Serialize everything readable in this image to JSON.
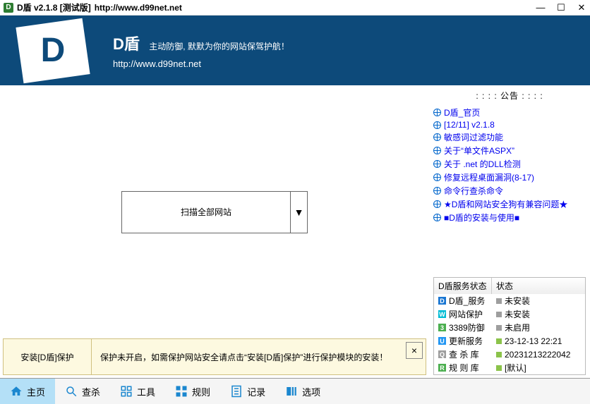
{
  "titlebar": {
    "icon_letter": "D",
    "title": "D盾 v2.1.8 [测试版]",
    "url": "http://www.d99net.net"
  },
  "banner": {
    "logo_letter": "D",
    "title": "D盾",
    "slogan": "主动防御, 默默为你的网站保驾护航！",
    "url": "http://www.d99net.net"
  },
  "scan": {
    "label": "扫描全部网站",
    "arrow": "▼"
  },
  "notice": {
    "button": "安装[D盾]保护",
    "text": "保护未开启，如需保护网站安全请点击“安装[D盾]保护”进行保护模块的安装！",
    "close": "×"
  },
  "announce": {
    "title": ": : : :  公告  : : : :",
    "items": [
      "D盾_官页",
      "[12/11] v2.1.8",
      "敏感词过滤功能",
      "关于“单文件ASPX”",
      "关于 .net 的DLL检测",
      "修复远程桌面漏洞(8-17)",
      "命令行查杀命令",
      "★D盾和网站安全狗有兼容问题★",
      "■D盾的安装与使用■"
    ]
  },
  "status": {
    "header_service": "D盾服务状态",
    "header_state": "状态",
    "rows": [
      {
        "icon": "D",
        "cls": "ico-d",
        "name": "D盾_服务",
        "dot": "",
        "value": "未安装"
      },
      {
        "icon": "W",
        "cls": "ico-w",
        "name": "网站保护",
        "dot": "",
        "value": "未安装"
      },
      {
        "icon": "3",
        "cls": "ico-3",
        "name": "3389防御",
        "dot": "",
        "value": "未启用"
      },
      {
        "icon": "U",
        "cls": "ico-u",
        "name": "更新服务",
        "dot": "green",
        "value": "23-12-13 22:21"
      },
      {
        "icon": "Q",
        "cls": "ico-k",
        "name": "查 杀 库",
        "dot": "green",
        "value": "20231213222042"
      },
      {
        "icon": "R",
        "cls": "ico-r",
        "name": "规 则 库",
        "dot": "green",
        "value": "[默认]"
      }
    ]
  },
  "nav": {
    "items": [
      {
        "key": "home",
        "label": "主页",
        "active": true
      },
      {
        "key": "scan",
        "label": "查杀",
        "active": false
      },
      {
        "key": "tools",
        "label": "工具",
        "active": false
      },
      {
        "key": "rules",
        "label": "规则",
        "active": false
      },
      {
        "key": "log",
        "label": "记录",
        "active": false
      },
      {
        "key": "options",
        "label": "选项",
        "active": false
      }
    ]
  }
}
